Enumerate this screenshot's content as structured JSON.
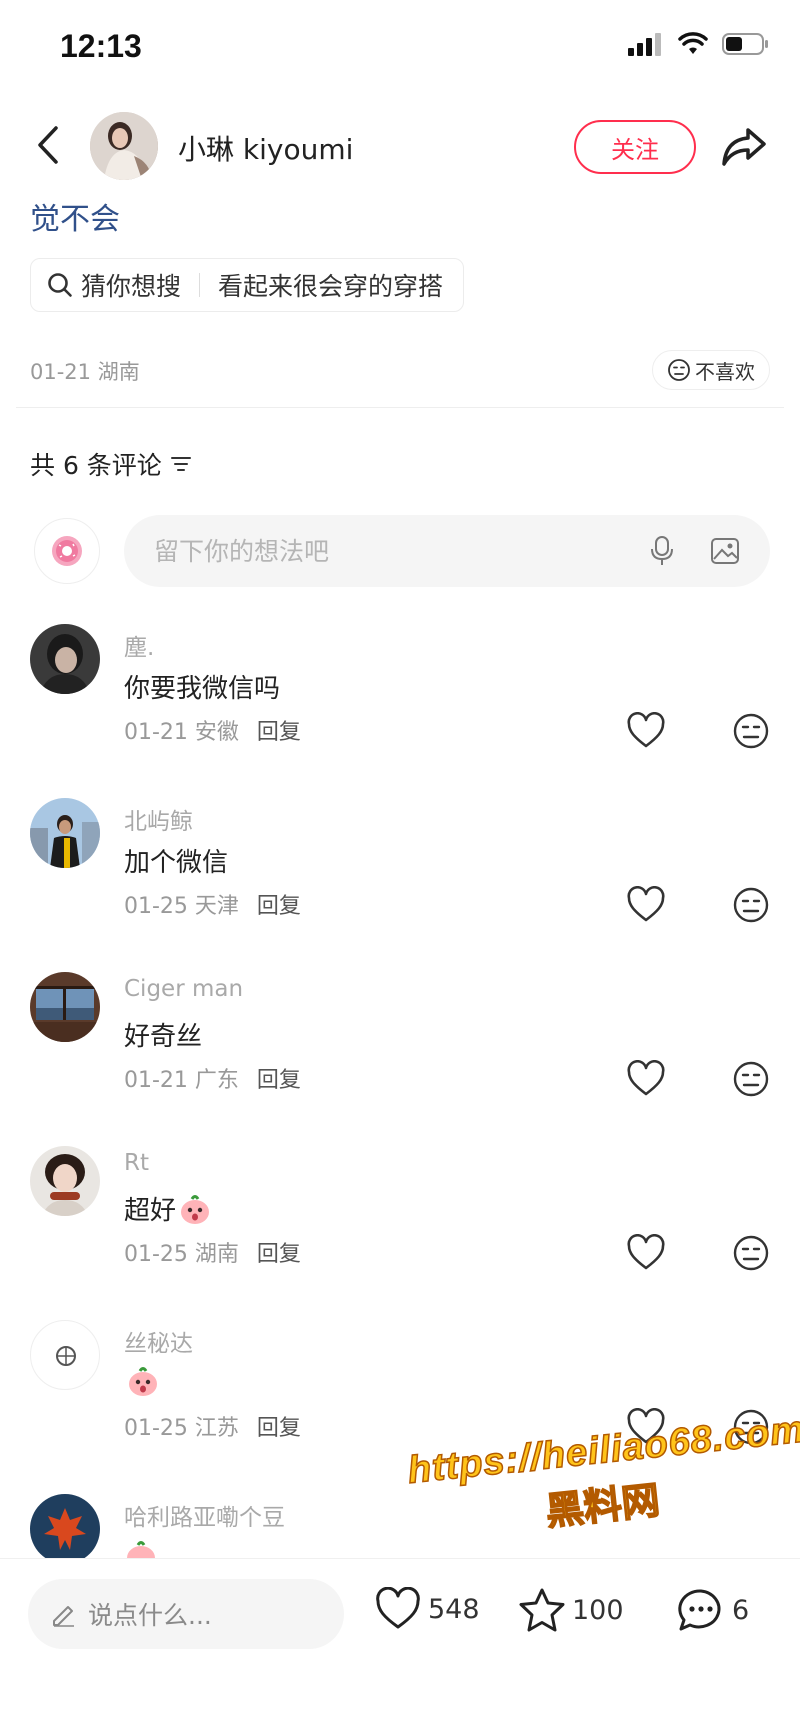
{
  "status": {
    "time": "12:13"
  },
  "author": {
    "name": "小琳 kiyoumi",
    "follow_label": "关注"
  },
  "post": {
    "title": "觉不会",
    "suggest_prefix": "猜你想搜",
    "suggest_query": "看起来很会穿的穿搭",
    "date_location": "01-21 湖南",
    "dislike_label": "不喜欢"
  },
  "comments_header": {
    "count_label": "共 6 条评论"
  },
  "comment_input": {
    "placeholder": "留下你的想法吧"
  },
  "comments": [
    {
      "user": "塵.",
      "text": "你要我微信吗",
      "date": "01-21 安徽",
      "reply": "回复"
    },
    {
      "user": "北屿鲸",
      "text": "加个微信",
      "date": "01-25 天津",
      "reply": "回复"
    },
    {
      "user": "Ciger man",
      "text": "好奇丝",
      "date": "01-21 广东",
      "reply": "回复"
    },
    {
      "user": "Rt",
      "text": "超好",
      "date": "01-25 湖南",
      "reply": "回复"
    },
    {
      "user": "丝秘达",
      "text": "",
      "date": "01-25 江苏",
      "reply": "回复"
    },
    {
      "user": "哈利路亚嘞个豆",
      "text": "",
      "date": "",
      "reply": ""
    }
  ],
  "watermark": {
    "url": "https://heiliao68.com",
    "name": "黑料网"
  },
  "bottom_bar": {
    "say_placeholder": "说点什么...",
    "likes": "548",
    "favorites": "100",
    "comments": "6"
  },
  "colors": {
    "accent": "#ff2e4d",
    "link_blue": "#30508a"
  },
  "icons": [
    "back-icon",
    "share-icon",
    "search-icon",
    "dislike-face-icon",
    "sort-icon",
    "mic-icon",
    "image-icon",
    "heart-icon",
    "star-icon",
    "comment-icon",
    "pen-icon"
  ]
}
